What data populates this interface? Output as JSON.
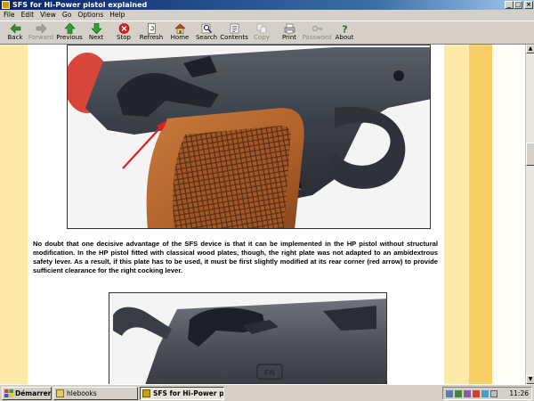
{
  "window": {
    "title": "SFS for Hi-Power pistol explained",
    "controls": [
      "_",
      "□",
      "×"
    ]
  },
  "menu": [
    "File",
    "Edit",
    "View",
    "Go",
    "Options",
    "Help"
  ],
  "toolbar": {
    "back": "Back",
    "forward": "Forward",
    "previous": "Previous",
    "next": "Next",
    "stop": "Stop",
    "refresh": "Refresh",
    "home": "Home",
    "search": "Search",
    "contents": "Contents",
    "copy": "Copy",
    "print": "Print",
    "password": "Password",
    "about": "About"
  },
  "content": {
    "paragraph": "No doubt that one decisive advantage of the SFS device is that it can be implemented in the HP pistol without structural modification. In the HP pistol fitted with classical wood plates, though, the right plate was not adapted to an ambidextrous safety lever. As a result, if this plate has to be used, it must be first slightly modified at its rear corner (red arrow) to provide sufficient clearance for the right cocking lever.",
    "photo2_logo": "FN"
  },
  "colors": {
    "band_light": "#fde9a8",
    "band_dark": "#f9cd66",
    "arrow": "#e02020"
  },
  "taskbar": {
    "start": "Démarrer",
    "tasks": [
      "hlebooks",
      "SFS for Hi-Power pisto..."
    ],
    "clock": "11:26"
  }
}
